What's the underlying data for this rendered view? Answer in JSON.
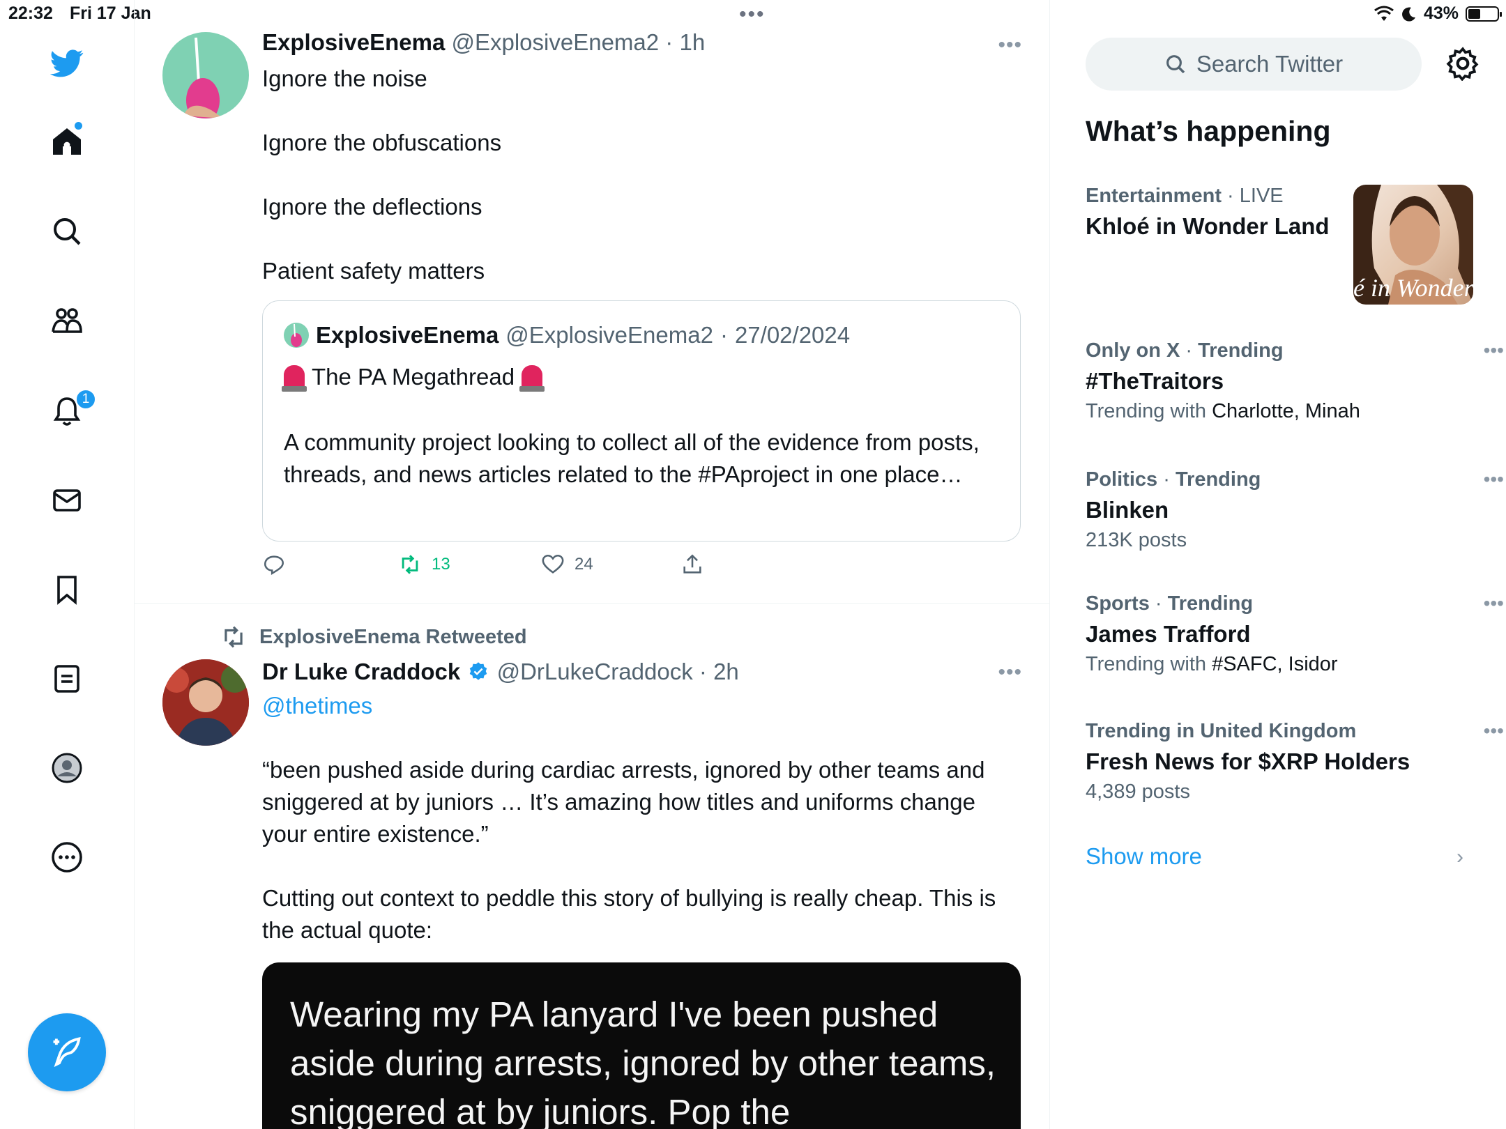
{
  "status_bar": {
    "time": "22:32",
    "date": "Fri 17 Jan",
    "battery": "43%",
    "battery_level": 0.43
  },
  "nav": {
    "notifications_badge": "1",
    "icons": [
      "twitter-logo-icon",
      "home-icon",
      "search-icon",
      "communities-icon",
      "notifications-icon",
      "messages-icon",
      "bookmarks-icon",
      "lists-icon",
      "profile-icon",
      "more-icon"
    ],
    "brand_color": "#1d9bf0"
  },
  "tweet1": {
    "name": "ExplosiveEnema",
    "handle": "@ExplosiveEnema2",
    "time": "1h",
    "text": "Ignore the noise\n\nIgnore the obfuscations\n\nIgnore the deflections\n\nPatient safety matters",
    "quote": {
      "name": "ExplosiveEnema",
      "handle": "@ExplosiveEnema2",
      "date": "27/02/2024",
      "title": "The PA Megathread",
      "body": "A community project looking to collect all of the evidence from posts, threads, and news articles related to the #PAproject in one place…"
    },
    "retweets": "13",
    "likes": "24"
  },
  "tweet2": {
    "retweeted_by": "ExplosiveEnema Retweeted",
    "name": "Dr Luke Craddock",
    "handle": "@DrLukeCraddock",
    "time": "2h",
    "mention": "@thetimes",
    "text": "“been pushed aside during cardiac arrests, ignored by other teams and sniggered at by juniors … It’s amazing how titles and uniforms change your entire existence.”\n\nCutting out context to peddle this story of bullying is really cheap. This is the actual quote:",
    "media_text": "Wearing my PA lanyard I've been pushed\naside during arrests, ignored by other teams,\nsniggered at by juniors. Pop the"
  },
  "sidebar": {
    "search_placeholder": "Search Twitter",
    "title": "What’s happening",
    "trends": [
      {
        "category": "Entertainment",
        "tag": "LIVE",
        "name": "Khloé in Wonder Land",
        "sub_label": "",
        "sub_value": ""
      },
      {
        "category": "Only on X",
        "tag": "Trending",
        "name": "#TheTraitors",
        "sub_label": "Trending with",
        "sub_value": "Charlotte, Minah"
      },
      {
        "category": "Politics",
        "tag": "Trending",
        "name": "Blinken",
        "sub_label": "213K posts",
        "sub_value": ""
      },
      {
        "category": "Sports",
        "tag": "Trending",
        "name": "James Trafford",
        "sub_label": "Trending with",
        "sub_value": "#SAFC, Isidor"
      },
      {
        "category": "Trending in United Kingdom",
        "tag": "",
        "name": "Fresh News for $XRP Holders",
        "sub_label": "4,389 posts",
        "sub_value": ""
      }
    ],
    "trend_image_text": "é in Wonder L",
    "show_more": "Show more"
  }
}
